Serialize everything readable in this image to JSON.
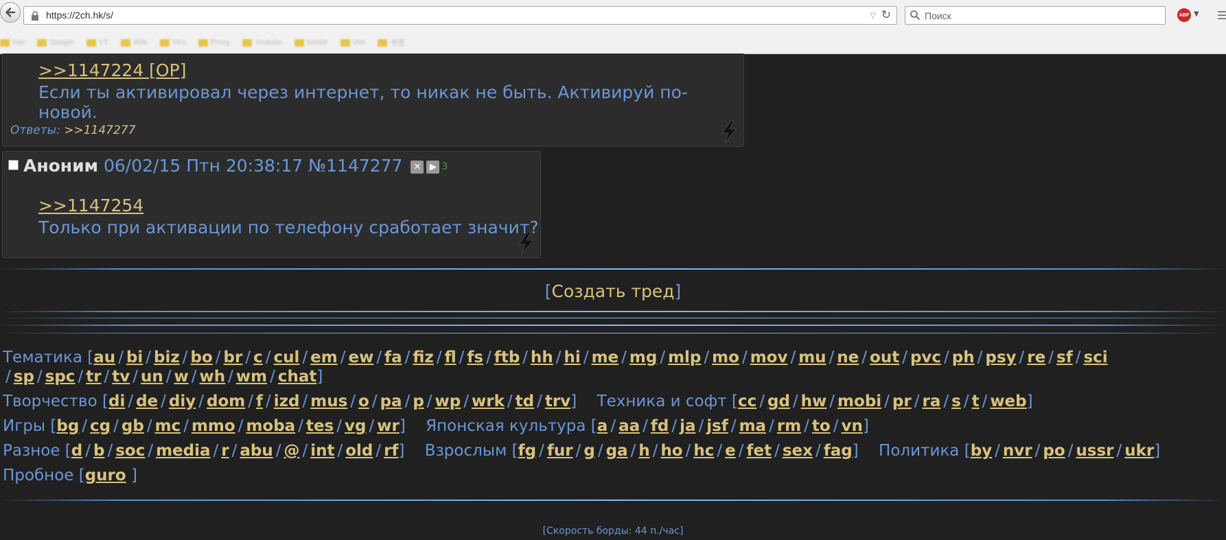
{
  "browser": {
    "url": "https://2ch.hk/s/",
    "search_placeholder": "Поиск",
    "bookmarks": [
      "Inet",
      "Google",
      "YT",
      "Wiki",
      "VKs",
      "Proxy",
      "Youtube",
      "tumblr",
      "Vim",
      "书签"
    ],
    "adblock_label": "ABP"
  },
  "post1": {
    "reflink": ">>1147224 [OP]",
    "text": "Если ты активировал через интернет, то никак не быть. Активируй по-новой.",
    "replies_label": "Ответы:",
    "replies_link": ">>1147277"
  },
  "post2": {
    "name": "Аноним",
    "date": "06/02/15 Птн 20:38:17",
    "number": "№1147277",
    "count": "3",
    "reflink": ">>1147254",
    "text": "Только при активации по телефону сработает значит?"
  },
  "create_thread": "Создать тред",
  "boards": [
    {
      "label": "Тематика",
      "links": [
        "au",
        "bi",
        "biz",
        "bo",
        "br",
        "c",
        "cul",
        "em",
        "ew",
        "fa",
        "fiz",
        "fl",
        "fs",
        "ftb",
        "hh",
        "hi",
        "me",
        "mg",
        "mlp",
        "mo",
        "mov",
        "mu",
        "ne",
        "out",
        "pvc",
        "ph",
        "psy",
        "re",
        "sf",
        "sci",
        "sp",
        "spc",
        "tr",
        "tv",
        "un",
        "w",
        "wh",
        "wm",
        "chat"
      ]
    },
    {
      "label": "Творчество",
      "links": [
        "di",
        "de",
        "diy",
        "dom",
        "f",
        "izd",
        "mus",
        "o",
        "pa",
        "p",
        "wp",
        "wrk",
        "td",
        "trv"
      ]
    },
    {
      "label": "Техника и софт",
      "links": [
        "cc",
        "gd",
        "hw",
        "mobi",
        "pr",
        "ra",
        "s",
        "t",
        "web"
      ]
    },
    {
      "label": "Игры",
      "links": [
        "bg",
        "cg",
        "gb",
        "mc",
        "mmo",
        "moba",
        "tes",
        "vg",
        "wr"
      ]
    },
    {
      "label": "Японская культура",
      "links": [
        "a",
        "aa",
        "fd",
        "ja",
        "jsf",
        "ma",
        "rm",
        "to",
        "vn"
      ]
    },
    {
      "label": "Разное",
      "links": [
        "d",
        "b",
        "soc",
        "media",
        "r",
        "abu",
        "@",
        "int",
        "old",
        "rf"
      ]
    },
    {
      "label": "Взрослым",
      "links": [
        "fg",
        "fur",
        "g",
        "ga",
        "h",
        "ho",
        "hc",
        "e",
        "fet",
        "sex",
        "fag"
      ]
    },
    {
      "label": "Политика",
      "links": [
        "by",
        "nvr",
        "po",
        "ussr",
        "ukr"
      ]
    },
    {
      "label": "Пробное",
      "links": [
        "guro"
      ]
    }
  ],
  "speed": "[Скорость борды: 44 п./час]"
}
